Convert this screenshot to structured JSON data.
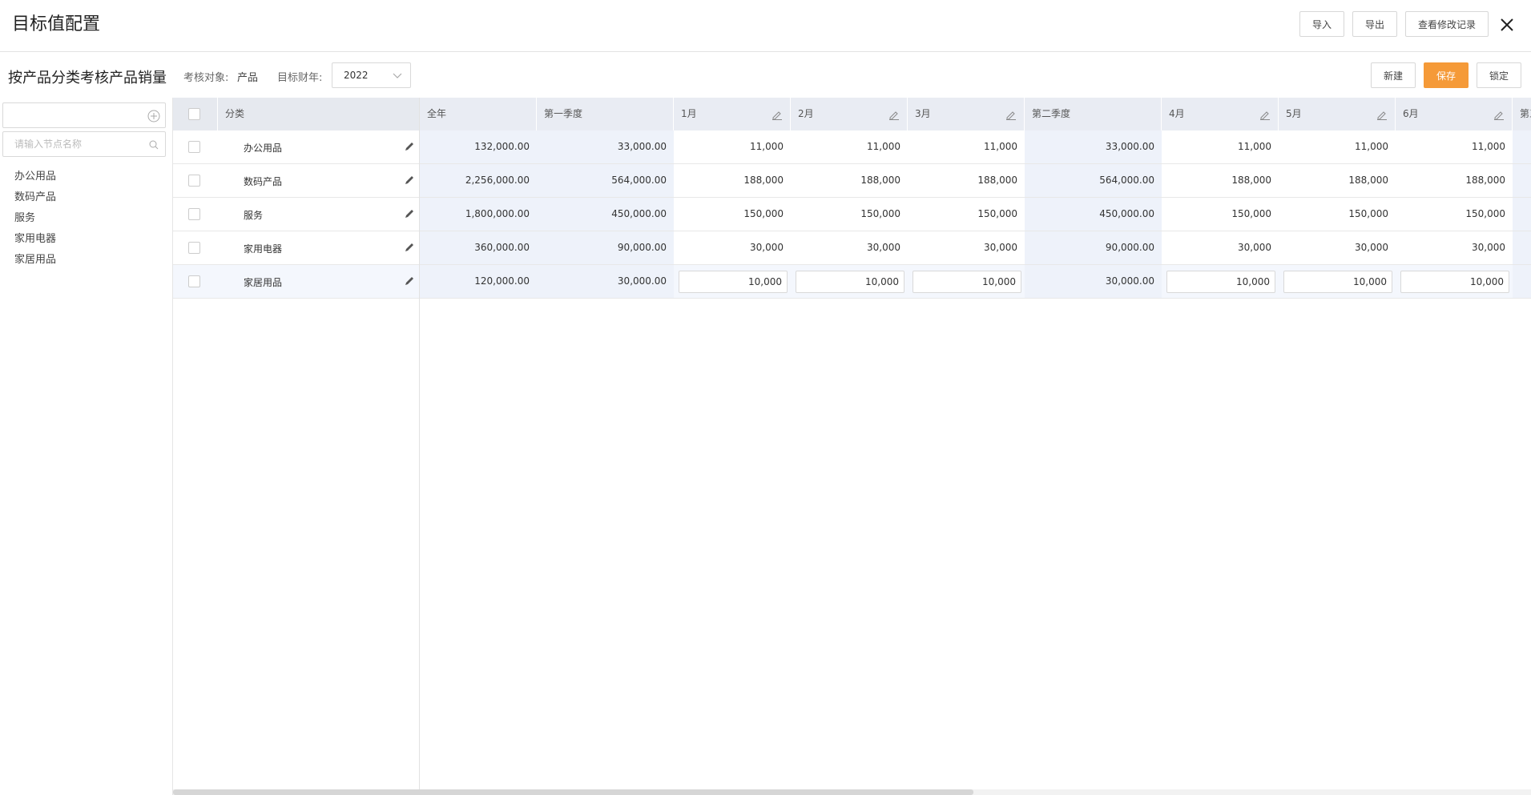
{
  "header": {
    "title": "目标值配置",
    "buttons": {
      "import": "导入",
      "export": "导出",
      "history": "查看修改记录"
    }
  },
  "toolbar": {
    "subtitle": "按产品分类考核产品销量",
    "target_label": "考核对象:",
    "target_value": "产品",
    "year_label": "目标财年:",
    "year_value": "2022",
    "new": "新建",
    "save": "保存",
    "lock": "锁定"
  },
  "sidebar": {
    "search_placeholder": "请输入节点名称",
    "items": [
      "办公用品",
      "数码产品",
      "服务",
      "家用电器",
      "家居用品"
    ]
  },
  "table": {
    "columns": [
      "分类",
      "全年",
      "第一季度",
      "1月",
      "2月",
      "3月",
      "第二季度",
      "4月",
      "5月",
      "6月",
      "第三季度"
    ],
    "rows": [
      {
        "name": "办公用品",
        "year": "132,000.00",
        "q1": "33,000.00",
        "m1": "11,000",
        "m2": "11,000",
        "m3": "11,000",
        "q2": "33,000.00",
        "m4": "11,000",
        "m5": "11,000",
        "m6": "11,000"
      },
      {
        "name": "数码产品",
        "year": "2,256,000.00",
        "q1": "564,000.00",
        "m1": "188,000",
        "m2": "188,000",
        "m3": "188,000",
        "q2": "564,000.00",
        "m4": "188,000",
        "m5": "188,000",
        "m6": "188,000"
      },
      {
        "name": "服务",
        "year": "1,800,000.00",
        "q1": "450,000.00",
        "m1": "150,000",
        "m2": "150,000",
        "m3": "150,000",
        "q2": "450,000.00",
        "m4": "150,000",
        "m5": "150,000",
        "m6": "150,000"
      },
      {
        "name": "家用电器",
        "year": "360,000.00",
        "q1": "90,000.00",
        "m1": "30,000",
        "m2": "30,000",
        "m3": "30,000",
        "q2": "90,000.00",
        "m4": "30,000",
        "m5": "30,000",
        "m6": "30,000"
      },
      {
        "name": "家居用品",
        "year": "120,000.00",
        "q1": "30,000.00",
        "m1": "10,000",
        "m2": "10,000",
        "m3": "10,000",
        "q2": "30,000.00",
        "m4": "10,000",
        "m5": "10,000",
        "m6": "10,000"
      }
    ]
  },
  "colors": {
    "accent": "#f59a38",
    "header_bg": "#e9ecf3",
    "summary_bg": "#eef2fa"
  }
}
